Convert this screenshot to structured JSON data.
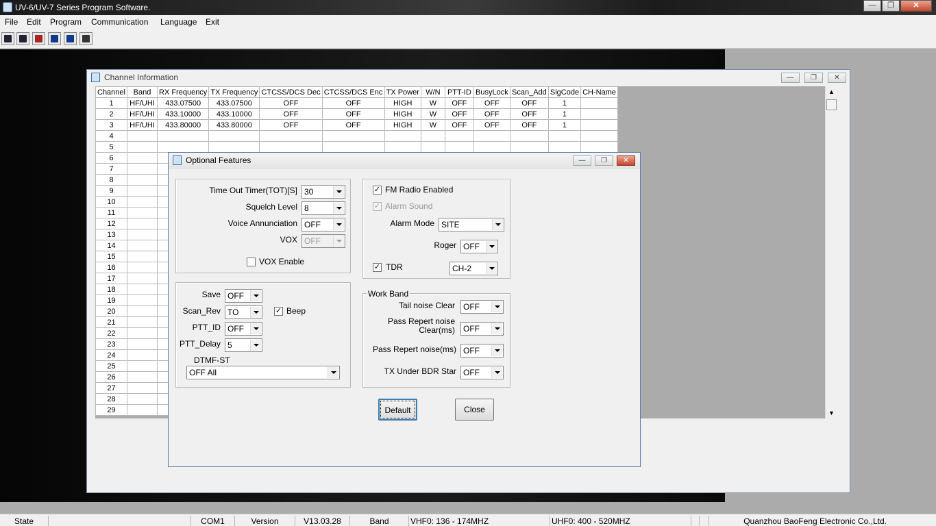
{
  "app": {
    "title": "UV-6/UV-7 Series Program Software."
  },
  "menu": [
    "File",
    "Edit",
    "Program",
    "Communication",
    "Language",
    "Exit"
  ],
  "toolbar_icons": [
    "open-icon",
    "save-icon",
    "read-radio-icon",
    "write-radio-icon",
    "program-icon",
    "cursor-icon"
  ],
  "channel_window": {
    "title": "Channel Information",
    "columns": [
      "Channel",
      "Band",
      "RX Frequency",
      "TX Frequency",
      "CTCSS/DCS Dec",
      "CTCSS/DCS Enc",
      "TX Power",
      "W/N",
      "PTT-ID",
      "BusyLock",
      "Scan_Add",
      "SigCode",
      "CH-Name"
    ],
    "rows": [
      [
        "1",
        "HF/UHI",
        "433.07500",
        "433.07500",
        "OFF",
        "OFF",
        "HIGH",
        "W",
        "OFF",
        "OFF",
        "OFF",
        "1",
        ""
      ],
      [
        "2",
        "HF/UHI",
        "433.10000",
        "433.10000",
        "OFF",
        "OFF",
        "HIGH",
        "W",
        "OFF",
        "OFF",
        "OFF",
        "1",
        ""
      ],
      [
        "3",
        "HF/UHI",
        "433.80000",
        "433.80000",
        "OFF",
        "OFF",
        "HIGH",
        "W",
        "OFF",
        "OFF",
        "OFF",
        "1",
        ""
      ],
      [
        "4",
        "",
        "",
        "",
        "",
        "",
        "",
        "",
        "",
        "",
        "",
        "",
        ""
      ],
      [
        "5",
        "",
        "",
        "",
        "",
        "",
        "",
        "",
        "",
        "",
        "",
        "",
        ""
      ],
      [
        "6",
        "",
        "",
        "",
        "",
        "",
        "",
        "",
        "",
        "",
        "",
        "",
        ""
      ],
      [
        "7",
        "",
        "",
        "",
        "",
        "",
        "",
        "",
        "",
        "",
        "",
        "",
        ""
      ],
      [
        "8",
        "",
        "",
        "",
        "",
        "",
        "",
        "",
        "",
        "",
        "",
        "",
        ""
      ],
      [
        "9",
        "",
        "",
        "",
        "",
        "",
        "",
        "",
        "",
        "",
        "",
        "",
        ""
      ],
      [
        "10",
        "",
        "",
        "",
        "",
        "",
        "",
        "",
        "",
        "",
        "",
        "",
        ""
      ],
      [
        "11",
        "",
        "",
        "",
        "",
        "",
        "",
        "",
        "",
        "",
        "",
        "",
        ""
      ],
      [
        "12",
        "",
        "",
        "",
        "",
        "",
        "",
        "",
        "",
        "",
        "",
        "",
        ""
      ],
      [
        "13",
        "",
        "",
        "",
        "",
        "",
        "",
        "",
        "",
        "",
        "",
        "",
        ""
      ],
      [
        "14",
        "",
        "",
        "",
        "",
        "",
        "",
        "",
        "",
        "",
        "",
        "",
        ""
      ],
      [
        "15",
        "",
        "",
        "",
        "",
        "",
        "",
        "",
        "",
        "",
        "",
        "",
        ""
      ],
      [
        "16",
        "",
        "",
        "",
        "",
        "",
        "",
        "",
        "",
        "",
        "",
        "",
        ""
      ],
      [
        "17",
        "",
        "",
        "",
        "",
        "",
        "",
        "",
        "",
        "",
        "",
        "",
        ""
      ],
      [
        "18",
        "",
        "",
        "",
        "",
        "",
        "",
        "",
        "",
        "",
        "",
        "",
        ""
      ],
      [
        "19",
        "",
        "",
        "",
        "",
        "",
        "",
        "",
        "",
        "",
        "",
        "",
        ""
      ],
      [
        "20",
        "",
        "",
        "",
        "",
        "",
        "",
        "",
        "",
        "",
        "",
        "",
        ""
      ],
      [
        "21",
        "",
        "",
        "",
        "",
        "",
        "",
        "",
        "",
        "",
        "",
        "",
        ""
      ],
      [
        "22",
        "",
        "",
        "",
        "",
        "",
        "",
        "",
        "",
        "",
        "",
        "",
        ""
      ],
      [
        "23",
        "",
        "",
        "",
        "",
        "",
        "",
        "",
        "",
        "",
        "",
        "",
        ""
      ],
      [
        "24",
        "",
        "",
        "",
        "",
        "",
        "",
        "",
        "",
        "",
        "",
        "",
        ""
      ],
      [
        "25",
        "",
        "",
        "",
        "",
        "",
        "",
        "",
        "",
        "",
        "",
        "",
        ""
      ],
      [
        "26",
        "",
        "",
        "",
        "",
        "",
        "",
        "",
        "",
        "",
        "",
        "",
        ""
      ],
      [
        "27",
        "",
        "",
        "",
        "",
        "",
        "",
        "",
        "",
        "",
        "",
        "",
        ""
      ],
      [
        "28",
        "",
        "",
        "",
        "",
        "",
        "",
        "",
        "",
        "",
        "",
        "",
        ""
      ],
      [
        "29",
        "",
        "",
        "",
        "",
        "",
        "",
        "",
        "",
        "",
        "",
        "",
        ""
      ]
    ]
  },
  "dialog": {
    "title": "Optional Features",
    "tot_label": "Time Out Timer(TOT)[S]",
    "tot_value": "30",
    "squelch_label": "Squelch Level",
    "squelch_value": "8",
    "voice_label": "Voice Annunciation",
    "voice_value": "OFF",
    "vox_label": "VOX",
    "vox_value": "OFF",
    "vox_enable_label": "VOX Enable",
    "vox_enable_checked": false,
    "save_label": "Save",
    "save_value": "OFF",
    "scanrev_label": "Scan_Rev",
    "scanrev_value": "TO",
    "beep_label": "Beep",
    "beep_checked": true,
    "pttid_label": "PTT_ID",
    "pttid_value": "OFF",
    "pttdelay_label": "PTT_Delay",
    "pttdelay_value": "5",
    "dtmf_label": "DTMF-ST",
    "dtmf_value": "OFF All",
    "fm_label": "FM Radio Enabled",
    "fm_checked": true,
    "alarmsound_label": "Alarm Sound",
    "alarmsound_checked": true,
    "alarmmode_label": "Alarm Mode",
    "alarmmode_value": "SITE",
    "roger_label": "Roger",
    "roger_value": "OFF",
    "tdr_label": "TDR",
    "tdr_checked": true,
    "tdr_value": "CH-2",
    "workband_label": "Work Band",
    "tailnoise_label": "Tail noise Clear",
    "tailnoise_value": "OFF",
    "passrepclear_label": "Pass Repert noise Clear(ms)",
    "passrepclear_value": "OFF",
    "passrep_label": "Pass Repert noise(ms)",
    "passrep_value": "OFF",
    "txunder_label": "TX Under BDR Star",
    "txunder_value": "OFF",
    "default_button": "Default",
    "close_button": "Close"
  },
  "status": {
    "state": "State",
    "port": "COM1",
    "version_label": "Version",
    "version": "V13.03.28",
    "band_label": "Band",
    "vhf": "VHF0: 136 -   174MHZ",
    "uhf": "UHF0: 400 -   520MHZ",
    "company": "Quanzhou BaoFeng Electronic Co.,Ltd."
  }
}
